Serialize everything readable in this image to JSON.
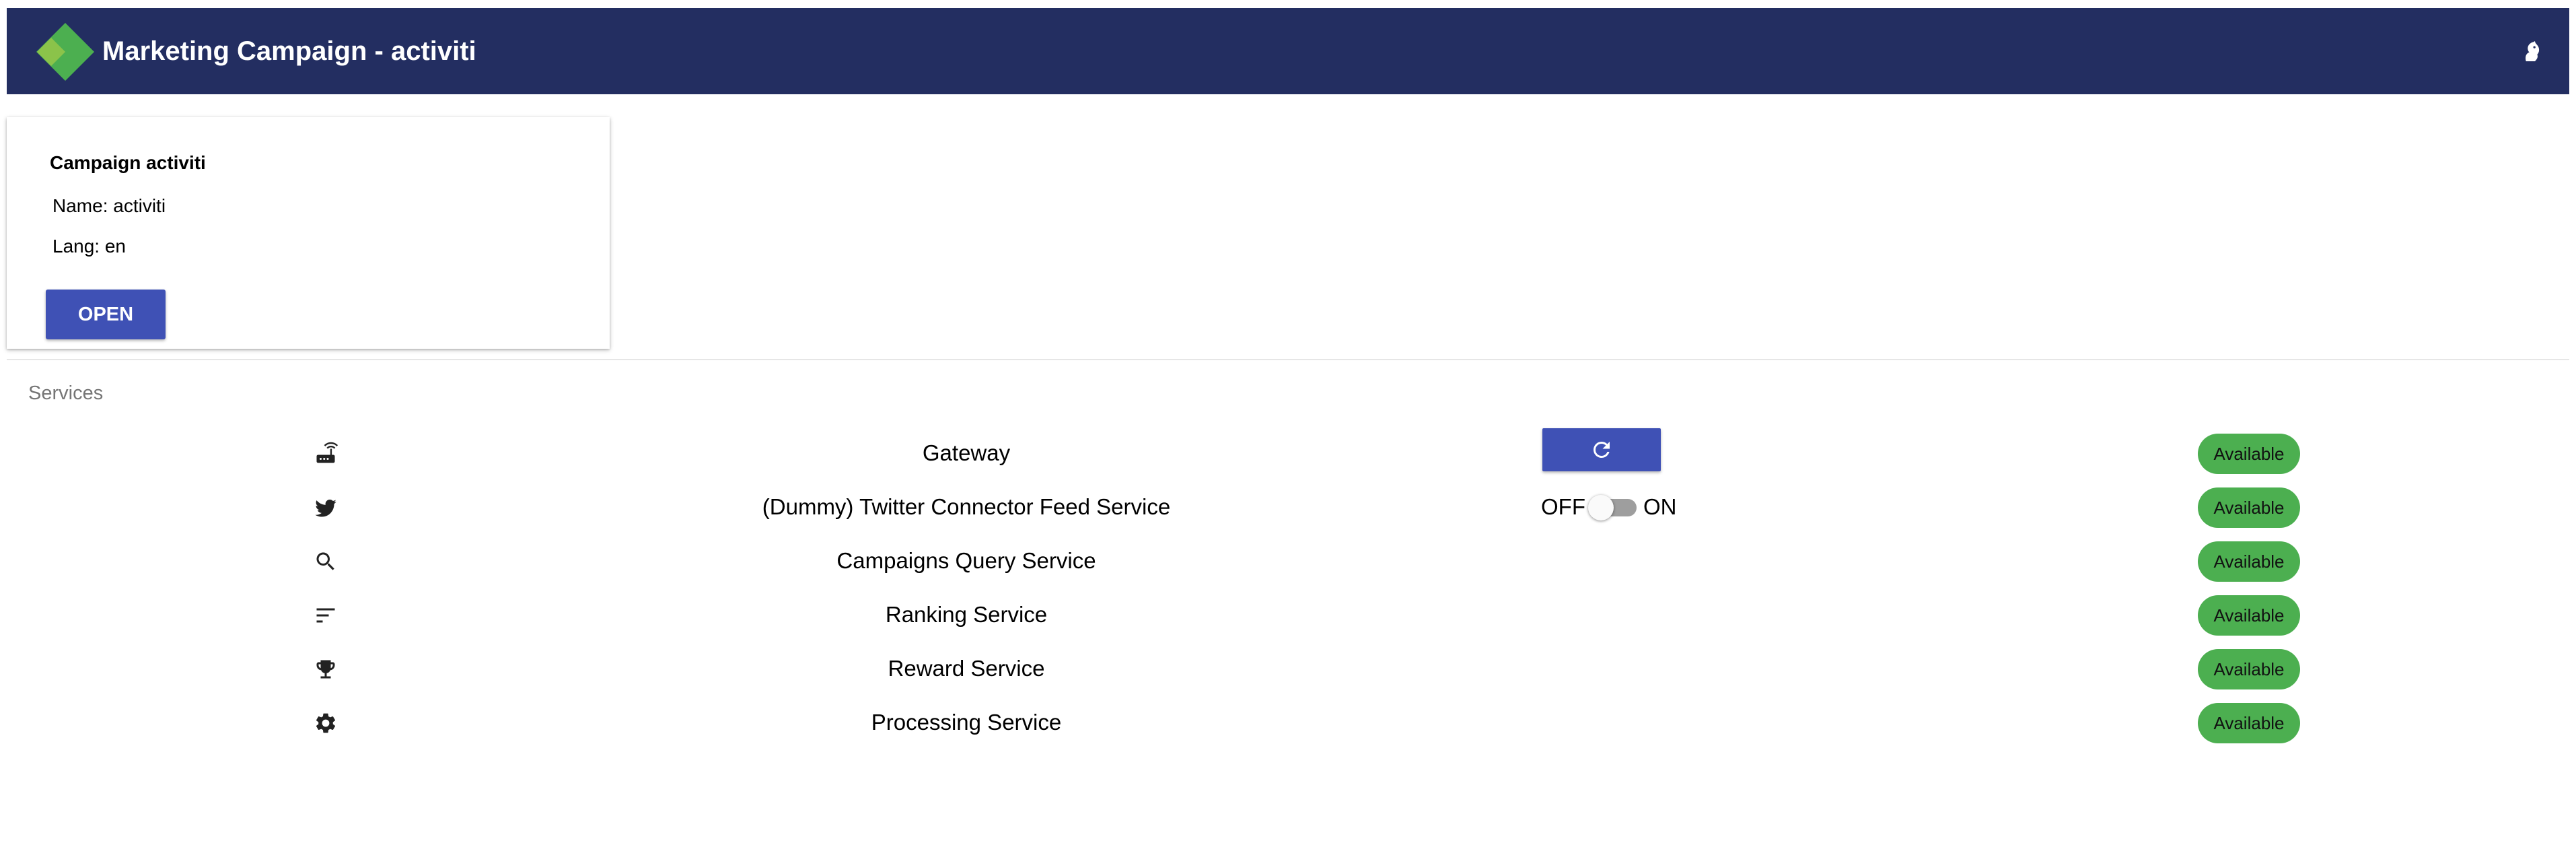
{
  "header": {
    "title": "Marketing Campaign - activiti",
    "logo_icon": "diamond-logo-icon",
    "user_icon": "user-account-icon",
    "bar_color": "#232e61",
    "logo_colors": [
      "#4caf50",
      "#8bc34a"
    ]
  },
  "campaign_card": {
    "title": "Campaign activiti",
    "name_line": "Name: activiti",
    "lang_line": "Lang: en",
    "open_label": "OPEN",
    "button_color": "#3f51b5"
  },
  "services": {
    "section_label": "Services",
    "status_color": "#4caf50",
    "items": [
      {
        "icon": "router-icon",
        "name": "Gateway",
        "control": "refresh-button",
        "control_icon": "refresh-icon",
        "status": "Available"
      },
      {
        "icon": "twitter-icon",
        "name": "(Dummy) Twitter Connector Feed Service",
        "control": "toggle",
        "toggle_off_label": "OFF",
        "toggle_on_label": "ON",
        "toggle_state": "off",
        "status": "Available"
      },
      {
        "icon": "search-icon",
        "name": "Campaigns Query Service",
        "status": "Available"
      },
      {
        "icon": "sort-icon",
        "name": "Ranking Service",
        "status": "Available"
      },
      {
        "icon": "trophy-icon",
        "name": "Reward Service",
        "status": "Available"
      },
      {
        "icon": "gear-icon",
        "name": "Processing Service",
        "status": "Available"
      }
    ]
  }
}
